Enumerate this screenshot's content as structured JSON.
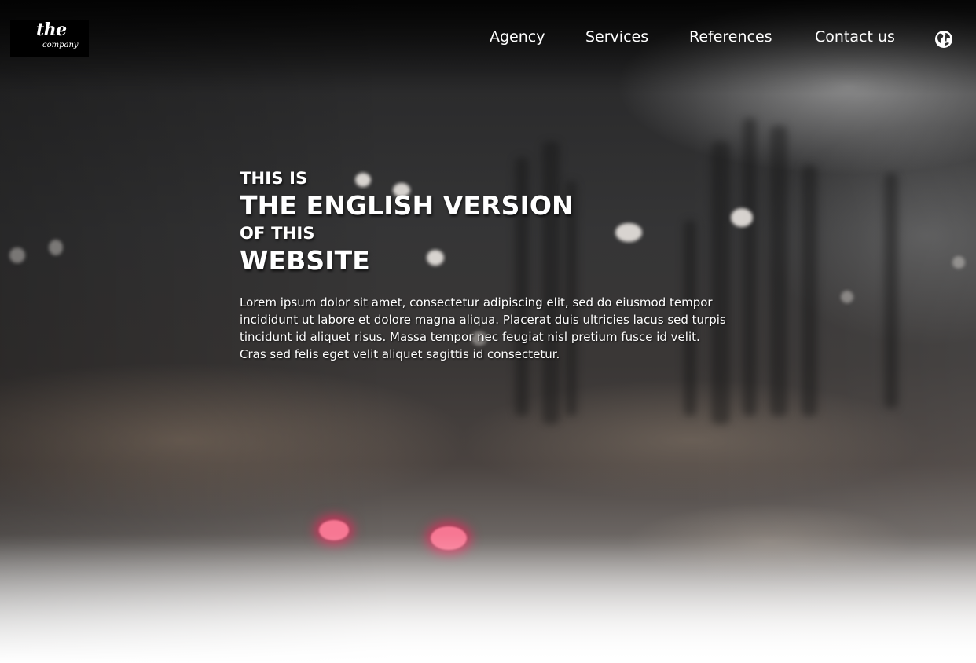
{
  "header": {
    "logo": {
      "line1": "the",
      "line2": "company"
    },
    "nav": [
      {
        "label": "Agency"
      },
      {
        "label": "Services"
      },
      {
        "label": "References"
      },
      {
        "label": "Contact us"
      }
    ],
    "language_icon": "globe-icon"
  },
  "hero": {
    "line1": "THIS IS",
    "line2": "THE ENGLISH VERSION",
    "line3": "OF THIS",
    "line4": "WEBSITE",
    "paragraph": "Lorem ipsum dolor sit amet, consectetur adipiscing elit, sed do eiusmod tempor incididunt ut labore et dolore magna aliqua. Placerat duis ultricies lacus sed turpis tincidunt id aliquet risus. Massa tempor nec feugiat nisl pretium fusce id velit. Cras sed felis eget velit aliquet sagittis id consectetur."
  },
  "colors": {
    "text": "#ffffff",
    "logo_background": "#000000"
  }
}
